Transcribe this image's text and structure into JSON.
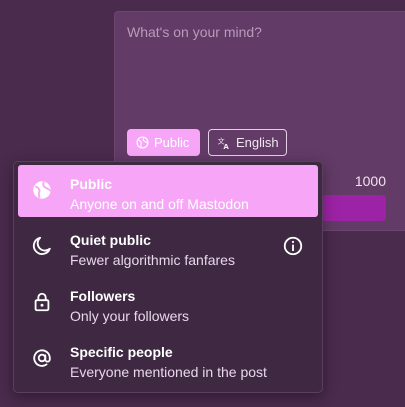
{
  "composer": {
    "placeholder": "What's on your mind?",
    "visibility_label": "Public",
    "language_label": "English",
    "char_count": "1000"
  },
  "visibility_menu": {
    "options": [
      {
        "title": "Public",
        "description": "Anyone on and off Mastodon",
        "icon": "globe-icon",
        "selected": true
      },
      {
        "title": "Quiet public",
        "description": "Fewer algorithmic fanfares",
        "icon": "moon-icon",
        "selected": false,
        "info_icon": "info-icon"
      },
      {
        "title": "Followers",
        "description": "Only your followers",
        "icon": "lock-icon",
        "selected": false
      },
      {
        "title": "Specific people",
        "description": "Everyone mentioned in the post",
        "icon": "at-sign-icon",
        "selected": false
      }
    ]
  },
  "colors": {
    "background": "#4a2a4d",
    "accent": "#f7a6f7",
    "post_button": "#9c23a5",
    "menu_background": "#3e2842"
  }
}
